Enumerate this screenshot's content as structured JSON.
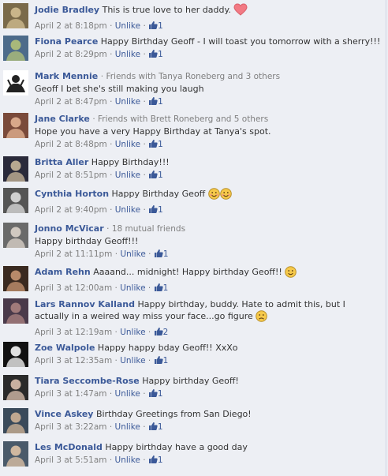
{
  "colors": {
    "link": "#3b5998",
    "meta": "#7f7f7f",
    "background": "#edeff4",
    "heart": "#f27a84",
    "emoji": "#f6c94a"
  },
  "ui": {
    "dot": "·",
    "unlike_label": "Unlike"
  },
  "comments": [
    {
      "author": "Jodie Bradley",
      "text": "This is true love to her daddy.",
      "time": "April 2 at 8:18pm",
      "likes": "1",
      "emoji": "heart-icon"
    },
    {
      "author": "Fiona Pearce",
      "text": "Happy Birthday Geoff - I will toast you tomorrow with a sherry!!!",
      "time": "April 2 at 8:29pm",
      "likes": "1"
    },
    {
      "author": "Mark Mennie",
      "mutual": "Friends with Tanya Roneberg and 3 others",
      "text": "Geoff I bet she's still making you laugh",
      "time": "April 2 at 8:47pm",
      "likes": "1"
    },
    {
      "author": "Jane Clarke",
      "mutual": "Friends with Brett Roneberg and 5 others",
      "text": "Hope you have a very Happy Birthday at Tanya's spot.",
      "time": "April 2 at 8:48pm",
      "likes": "1"
    },
    {
      "author": "Britta Aller",
      "text": "Happy Birthday!!!",
      "time": "April 2 at 8:51pm",
      "likes": "1"
    },
    {
      "author": "Cynthia Horton",
      "text": "Happy Birthday Geoff",
      "time": "April 2 at 9:40pm",
      "likes": "1",
      "emoji": "blush-smiley-icon"
    },
    {
      "author": "Jonno McVicar",
      "mutual": "18 mutual friends",
      "text": "Happy birthday Geoff!!!",
      "time": "April 2 at 11:11pm",
      "likes": "1"
    },
    {
      "author": "Adam Rehn",
      "text": "Aaaand... midnight! Happy birthday Geoff!!",
      "time": "April 3 at 12:00am",
      "likes": "1",
      "emoji": "smiley-icon"
    },
    {
      "author": "Lars Rannov Kalland",
      "text": "Happy birthday, buddy. Hate to admit this, but I actually in a weired way miss your face...go figure",
      "time": "April 3 at 12:19am",
      "likes": "2",
      "emoji": "frown-icon"
    },
    {
      "author": "Zoe Walpole",
      "text": "Happy happy bday Geoff!! XxXo",
      "time": "April 3 at 12:35am",
      "likes": "1"
    },
    {
      "author": "Tiara Seccombe-Rose",
      "text": "Happy birthday Geoff!",
      "time": "April 3 at 1:47am",
      "likes": "1"
    },
    {
      "author": "Vince Askey",
      "text": "Birthday Greetings from San Diego!",
      "time": "April 3 at 3:22am",
      "likes": "1"
    },
    {
      "author": "Les McDonald",
      "text": "Happy birthday have a good day",
      "time": "April 3 at 5:51am",
      "likes": "1"
    }
  ]
}
